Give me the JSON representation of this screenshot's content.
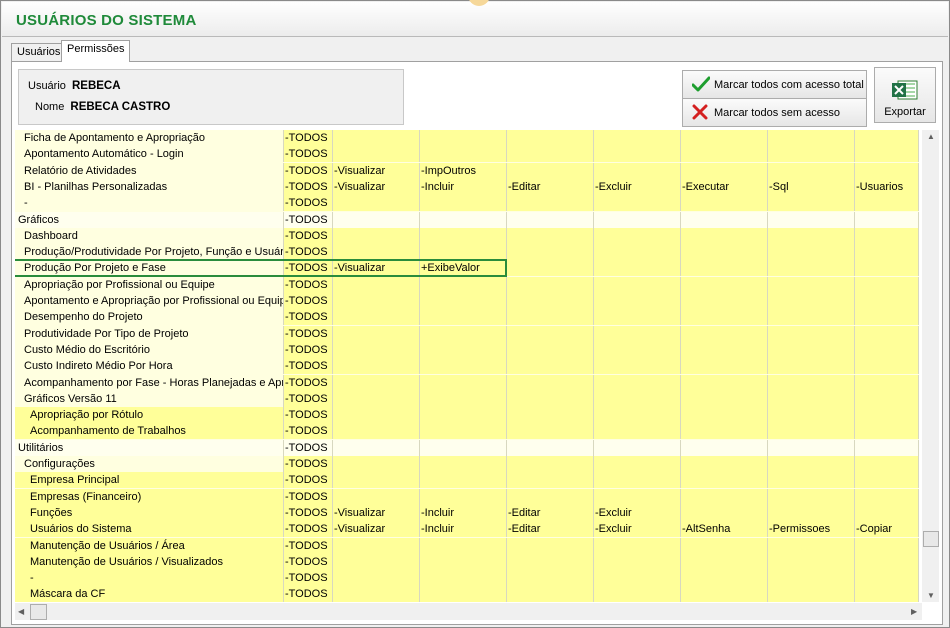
{
  "title": "USUÁRIOS DO SISTEMA",
  "tabs": [
    {
      "label": "Usuários"
    },
    {
      "label": "Permissões"
    }
  ],
  "user": {
    "usuario_label": "Usuário",
    "usuario_value": "REBECA",
    "nome_label": "Nome",
    "nome_value": "REBECA CASTRO"
  },
  "buttons": {
    "mark_all": "Marcar todos com acesso total",
    "mark_none": "Marcar todos sem acesso",
    "export": "Exportar"
  },
  "colors": {
    "title": "#1f8a3a",
    "yellow": "#ffff99",
    "light_yellow": "#ffffe0",
    "group": "#ffffee",
    "selection": "#2a8c3c"
  },
  "icons": {
    "mark_all": "green-check-icon",
    "mark_none": "red-x-icon",
    "export": "excel-icon"
  },
  "rows": [
    {
      "indent": 1,
      "name": "Ficha de Apontamento e Apropriação",
      "perms": [
        "-TODOS"
      ]
    },
    {
      "indent": 1,
      "name": "Apontamento Automático - Login",
      "perms": [
        "-TODOS"
      ]
    },
    {
      "indent": 1,
      "name": "Relatório de Atividades",
      "perms": [
        "-TODOS",
        "-Visualizar",
        "-ImpOutros"
      ]
    },
    {
      "indent": 1,
      "name": "BI - Planilhas Personalizadas",
      "perms": [
        "-TODOS",
        "-Visualizar",
        "-Incluir",
        "-Editar",
        "-Excluir",
        "-Executar",
        "-Sql",
        "-Usuarios"
      ]
    },
    {
      "indent": 1,
      "name": "-",
      "perms": [
        "-TODOS"
      ]
    },
    {
      "indent": 0,
      "name": "Gráficos",
      "perms": [
        "-TODOS"
      ]
    },
    {
      "indent": 1,
      "name": "Dashboard",
      "perms": [
        "-TODOS"
      ]
    },
    {
      "indent": 1,
      "name": "Produção/Produtividade Por Projeto, Função e Usuário",
      "perms": [
        "-TODOS"
      ]
    },
    {
      "indent": 1,
      "name": "Produção Por Projeto e Fase",
      "perms": [
        "-TODOS",
        "-Visualizar",
        "+ExibeValor"
      ],
      "selected": true
    },
    {
      "indent": 1,
      "name": "Apropriação por Profissional ou Equipe",
      "perms": [
        "-TODOS"
      ]
    },
    {
      "indent": 1,
      "name": "Apontamento e Apropriação por Profissional ou Equipe",
      "perms": [
        "-TODOS"
      ]
    },
    {
      "indent": 1,
      "name": "Desempenho do Projeto",
      "perms": [
        "-TODOS"
      ]
    },
    {
      "indent": 1,
      "name": "Produtividade Por Tipo de Projeto",
      "perms": [
        "-TODOS"
      ]
    },
    {
      "indent": 1,
      "name": "Custo Médio do Escritório",
      "perms": [
        "-TODOS"
      ]
    },
    {
      "indent": 1,
      "name": "Custo Indireto Médio Por Hora",
      "perms": [
        "-TODOS"
      ]
    },
    {
      "indent": 1,
      "name": "Acompanhamento por Fase - Horas Planejadas e Apropriadas",
      "perms": [
        "-TODOS"
      ]
    },
    {
      "indent": 1,
      "name": "Gráficos Versão 11",
      "perms": [
        "-TODOS"
      ]
    },
    {
      "indent": 2,
      "name": "Apropriação por Rótulo",
      "perms": [
        "-TODOS"
      ]
    },
    {
      "indent": 2,
      "name": "Acompanhamento de Trabalhos",
      "perms": [
        "-TODOS"
      ]
    },
    {
      "indent": 0,
      "name": "Utilitários",
      "perms": [
        "-TODOS"
      ]
    },
    {
      "indent": 1,
      "name": "Configurações",
      "perms": [
        "-TODOS"
      ]
    },
    {
      "indent": 2,
      "name": "Empresa Principal",
      "perms": [
        "-TODOS"
      ]
    },
    {
      "indent": 2,
      "name": "Empresas (Financeiro)",
      "perms": [
        "-TODOS"
      ]
    },
    {
      "indent": 2,
      "name": "Funções",
      "perms": [
        "-TODOS",
        "-Visualizar",
        "-Incluir",
        "-Editar",
        "-Excluir"
      ]
    },
    {
      "indent": 2,
      "name": "Usuários do Sistema",
      "perms": [
        "-TODOS",
        "-Visualizar",
        "-Incluir",
        "-Editar",
        "-Excluir",
        "-AltSenha",
        "-Permissoes",
        "-Copiar"
      ]
    },
    {
      "indent": 2,
      "name": "Manutenção de Usuários / Área",
      "perms": [
        "-TODOS"
      ]
    },
    {
      "indent": 2,
      "name": "Manutenção de Usuários / Visualizados",
      "perms": [
        "-TODOS"
      ]
    },
    {
      "indent": 2,
      "name": "-",
      "perms": [
        "-TODOS"
      ]
    },
    {
      "indent": 2,
      "name": "Máscara da CF",
      "perms": [
        "-TODOS"
      ]
    }
  ]
}
